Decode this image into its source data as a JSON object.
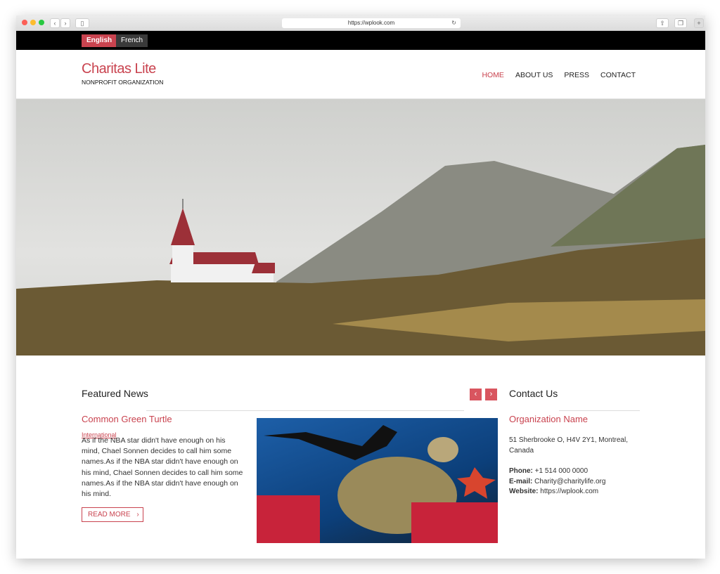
{
  "browser": {
    "url": "https://wplook.com"
  },
  "languages": [
    {
      "label": "English",
      "active": true
    },
    {
      "label": "French",
      "active": false
    }
  ],
  "site": {
    "title": "Charitas Lite",
    "tagline": "NONPROFIT ORGANIZATION"
  },
  "nav": [
    "HOME",
    "ABOUT US",
    "PRESS",
    "CONTACT"
  ],
  "featured": {
    "heading": "Featured News",
    "post_title": "Common Green Turtle",
    "category": "International",
    "excerpt": "As if the NBA star didn't have enough on his mind, Chael Sonnen decides to call him some names.As if the NBA star didn't have enough on his mind, Chael Sonnen decides to call him some names.As if the NBA star didn't have enough on his mind.",
    "read_more": "READ MORE"
  },
  "contact": {
    "heading": "Contact Us",
    "org": "Organization Name",
    "address": "51 Sherbrooke O, H4V 2Y1, Montreal, Canada",
    "phone_label": "Phone:",
    "phone": "+1 514 000 0000",
    "email_label": "E-mail:",
    "email": "Charity@charitylife.org",
    "website_label": "Website:",
    "website": "https://wplook.com"
  },
  "colors": {
    "accent": "#c9434f",
    "topbar": "#000000"
  }
}
